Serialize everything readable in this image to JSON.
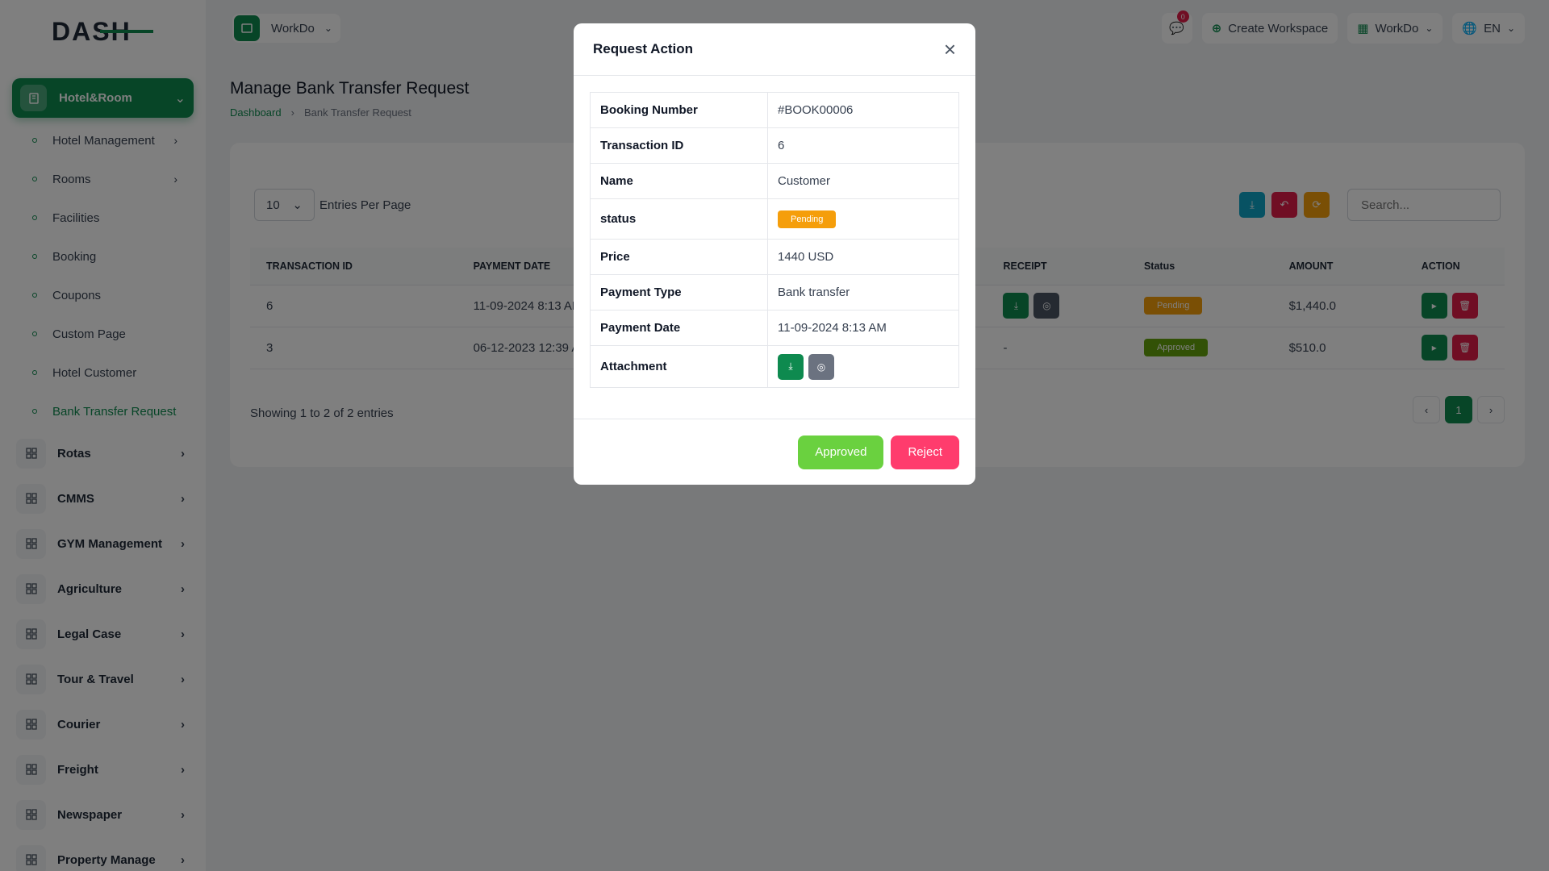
{
  "brand": {
    "logo": "DASH"
  },
  "sidebar": {
    "active_group": "Hotel&Room",
    "sub_items": [
      {
        "label": "Hotel Management",
        "has_chevron": true
      },
      {
        "label": "Rooms",
        "has_chevron": true
      },
      {
        "label": "Facilities",
        "has_chevron": false
      },
      {
        "label": "Booking",
        "has_chevron": false
      },
      {
        "label": "Coupons",
        "has_chevron": false
      },
      {
        "label": "Custom Page",
        "has_chevron": false
      },
      {
        "label": "Hotel Customer",
        "has_chevron": false
      },
      {
        "label": "Bank Transfer Request",
        "has_chevron": false,
        "active": true
      }
    ],
    "groups": [
      {
        "label": "Rotas",
        "icon": "grid-icon"
      },
      {
        "label": "CMMS",
        "icon": "cluster-icon"
      },
      {
        "label": "GYM Management",
        "icon": "dumbbell-icon"
      },
      {
        "label": "Agriculture",
        "icon": "plant-icon"
      },
      {
        "label": "Legal Case",
        "icon": "list-icon"
      },
      {
        "label": "Tour & Travel",
        "icon": "grid-icon"
      },
      {
        "label": "Courier",
        "icon": "box-icon"
      },
      {
        "label": "Freight",
        "icon": "ship-icon"
      },
      {
        "label": "Newspaper",
        "icon": "newspaper-icon"
      },
      {
        "label": "Property Manage",
        "icon": "building-icon"
      }
    ]
  },
  "header": {
    "workspace": "WorkDo",
    "notification_count": "0",
    "create_workspace": "Create Workspace",
    "workspace_menu": "WorkDo",
    "language": "EN"
  },
  "page": {
    "title": "Manage Bank Transfer Request",
    "breadcrumb_home": "Dashboard",
    "breadcrumb_current": "Bank Transfer Request"
  },
  "table": {
    "entries_value": "10",
    "entries_label": "Entries Per Page",
    "search_placeholder": "Search...",
    "columns": [
      "TRANSACTION ID",
      "PAYMENT DATE",
      "RECEIPT",
      "Status",
      "AMOUNT",
      "ACTION"
    ],
    "rows": [
      {
        "id": "6",
        "date": "11-09-2024 8:13 AM",
        "receipt": "",
        "status": "Pending",
        "amount": "$1,440.0"
      },
      {
        "id": "3",
        "date": "06-12-2023 12:39 AM",
        "receipt": "-",
        "status": "Approved",
        "amount": "$510.0"
      }
    ],
    "showing": "Showing 1 to 2 of 2 entries",
    "current_page": "1"
  },
  "modal": {
    "title": "Request Action",
    "fields": [
      {
        "key": "Booking Number",
        "value": "#BOOK00006"
      },
      {
        "key": "Transaction ID",
        "value": "6"
      },
      {
        "key": "Name",
        "value": "Customer"
      },
      {
        "key": "status",
        "value": "Pending"
      },
      {
        "key": "Price",
        "value": "1440 USD"
      },
      {
        "key": "Payment Type",
        "value": "Bank transfer"
      },
      {
        "key": "Payment Date",
        "value": "11-09-2024 8:13 AM"
      },
      {
        "key": "Attachment",
        "value": ""
      }
    ],
    "approve_label": "Approved",
    "reject_label": "Reject"
  },
  "colors": {
    "primary": "#0e8a4f",
    "pending": "#f59e0b",
    "approved": "#65a30d",
    "danger": "#e11d48",
    "approve_button": "#6ad13f",
    "reject_button": "#ff3c6d"
  }
}
